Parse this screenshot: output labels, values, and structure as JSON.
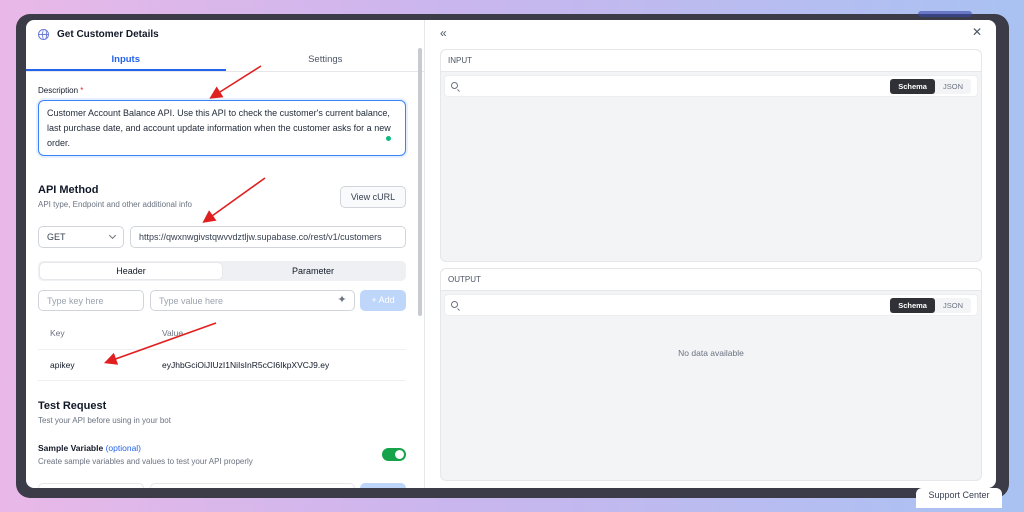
{
  "header": {
    "title": "Get Customer Details"
  },
  "tabs": [
    {
      "label": "Inputs"
    },
    {
      "label": "Settings"
    }
  ],
  "description": {
    "label": "Description",
    "required_mark": "*",
    "value": "Customer Account Balance API. Use this API to check the customer's current balance, last purchase date, and account update information when the customer asks for a new order."
  },
  "api_method": {
    "title": "API Method",
    "subtitle": "API type, Endpoint and other additional info",
    "view_curl_label": "View cURL",
    "method": "GET",
    "url": "https://qwxnwgivstqwvvdztljw.supabase.co/rest/v1/customers"
  },
  "segment": [
    {
      "label": "Header"
    },
    {
      "label": "Parameter"
    }
  ],
  "header_inputs": {
    "key_placeholder": "Type key here",
    "value_placeholder": "Type value here",
    "add_label": "+ Add"
  },
  "header_table": {
    "columns": [
      "Key",
      "Value"
    ],
    "rows": [
      {
        "key": "apikey",
        "value": "eyJhbGciOiJIUzI1NiIsInR5cCI6IkpXVCJ9.ey"
      }
    ]
  },
  "test_request": {
    "title": "Test Request",
    "subtitle": "Test your API before using in your bot",
    "sample_label": "Sample Variable",
    "sample_optional": "(optional)",
    "sample_desc": "Create sample variables and values to test your API properly",
    "sample_enabled": true
  },
  "right_panel": {
    "input_title": "INPUT",
    "output_title": "OUTPUT",
    "view_options": [
      "Schema",
      "JSON"
    ],
    "selected_view": "Schema",
    "output_empty": "No data available"
  },
  "support_label": "Support Center",
  "colors": {
    "accent": "#2563eb",
    "toggle_on": "#16a34a",
    "annotation_arrow": "#e02020"
  }
}
